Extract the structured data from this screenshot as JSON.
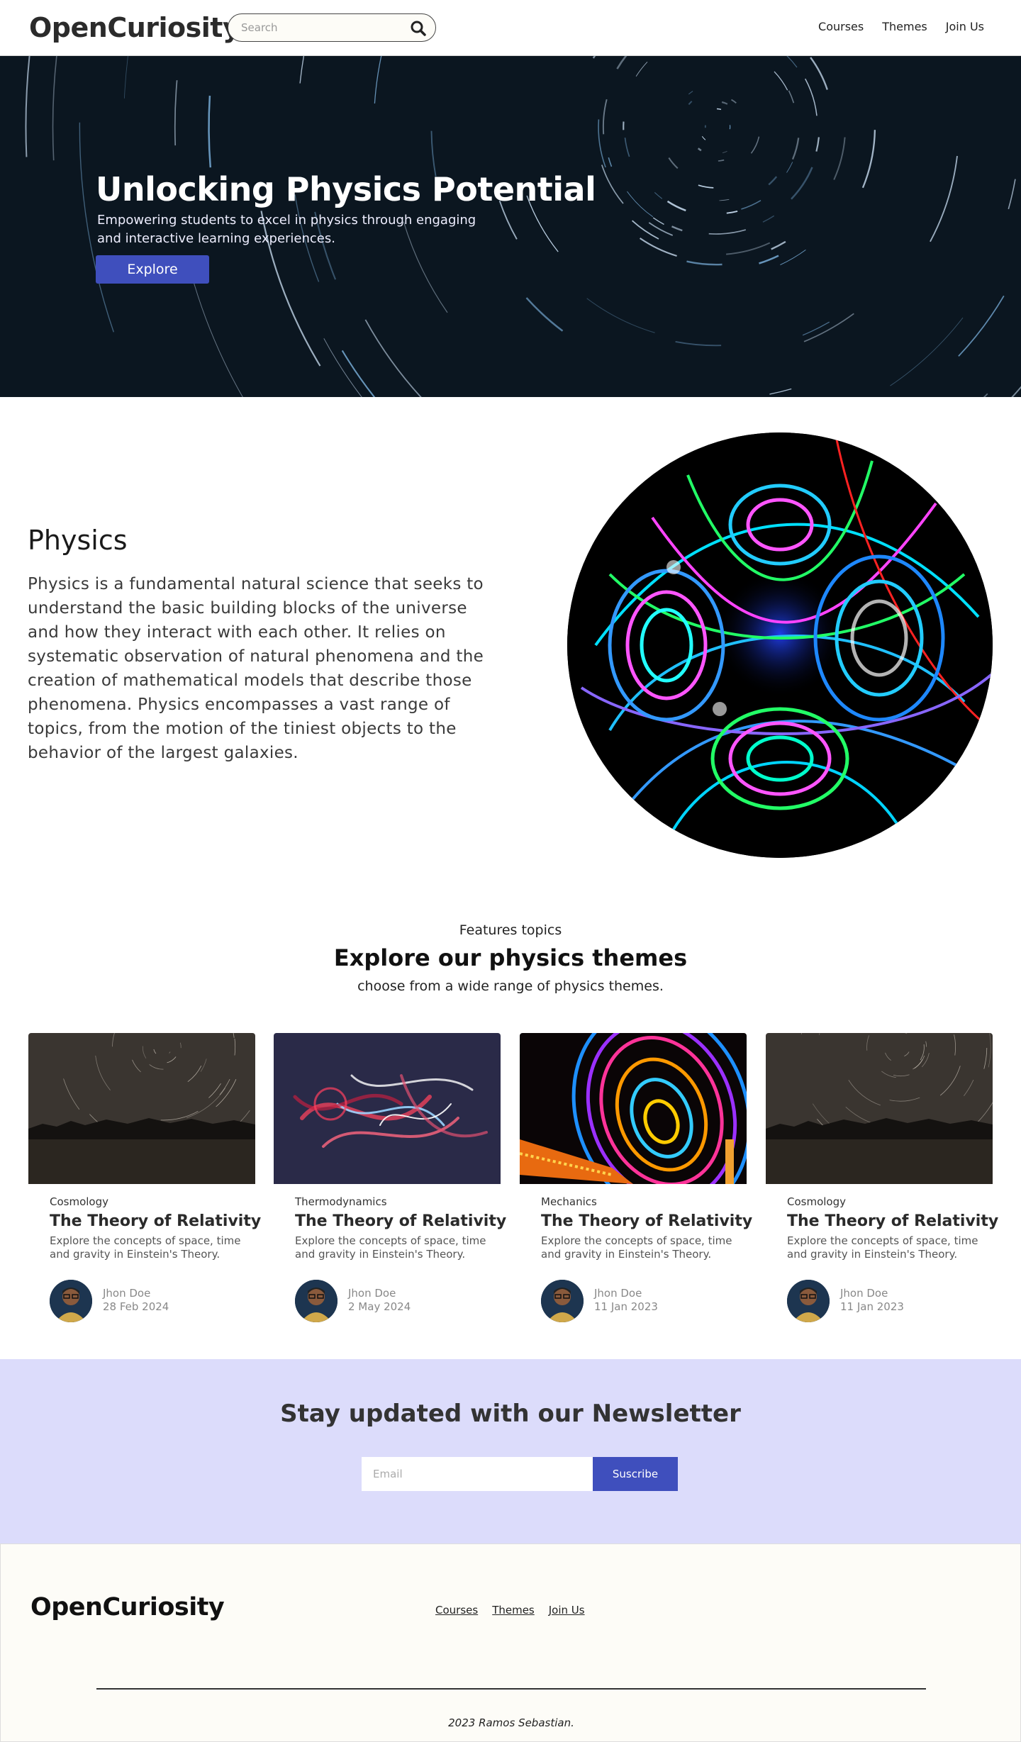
{
  "header": {
    "logo": "OpenCuriosity",
    "search_placeholder": "Search",
    "nav": [
      "Courses",
      "Themes",
      "Join Us"
    ]
  },
  "hero": {
    "title": "Unlocking Physics Potential",
    "subtitle": "Empowering students to excel in physics through engaging and interactive learning experiences.",
    "button": "Explore"
  },
  "about": {
    "title": "Physics",
    "text": "Physics is a fundamental natural science that seeks to understand the basic building blocks of the universe and how they interact with each other. It relies on systematic observation of natural phenomena and the creation of mathematical models that describe those phenomena. Physics encompasses a vast range of topics, from the motion of the tiniest objects to the behavior of the largest galaxies."
  },
  "themes": {
    "label": "Features topics",
    "title": "Explore our physics themes",
    "subtitle": "choose from a wide range of physics themes.",
    "cards": [
      {
        "category": "Cosmology",
        "title": "The Theory of Relativity",
        "description": "Explore the concepts of space, time and gravity in Einstein's Theory.",
        "author": "Jhon Doe",
        "date": "28 Feb 2024"
      },
      {
        "category": "Thermodynamics",
        "title": "The Theory of Relativity",
        "description": "Explore the concepts of space, time and gravity in Einstein's Theory.",
        "author": "Jhon Doe",
        "date": "2 May 2024"
      },
      {
        "category": "Mechanics",
        "title": "The Theory of Relativity",
        "description": "Explore the concepts of space, time and gravity in Einstein's Theory.",
        "author": "Jhon Doe",
        "date": "11 Jan 2023"
      },
      {
        "category": "Cosmology",
        "title": "The Theory of Relativity",
        "description": "Explore the concepts of space, time and gravity in Einstein's Theory.",
        "author": "Jhon Doe",
        "date": "11 Jan 2023"
      }
    ]
  },
  "newsletter": {
    "title": "Stay updated with our Newsletter",
    "email_placeholder": "Email",
    "button": "Suscribe"
  },
  "footer": {
    "logo": "OpenCuriosity",
    "nav": [
      "Courses",
      "Themes",
      "Join Us"
    ],
    "copyright": "2023  Ramos Sebastian."
  },
  "colors": {
    "accent": "#3f4fbd",
    "newsletter_bg": "#dcdcfb",
    "footer_bg": "#fdfcf7"
  }
}
